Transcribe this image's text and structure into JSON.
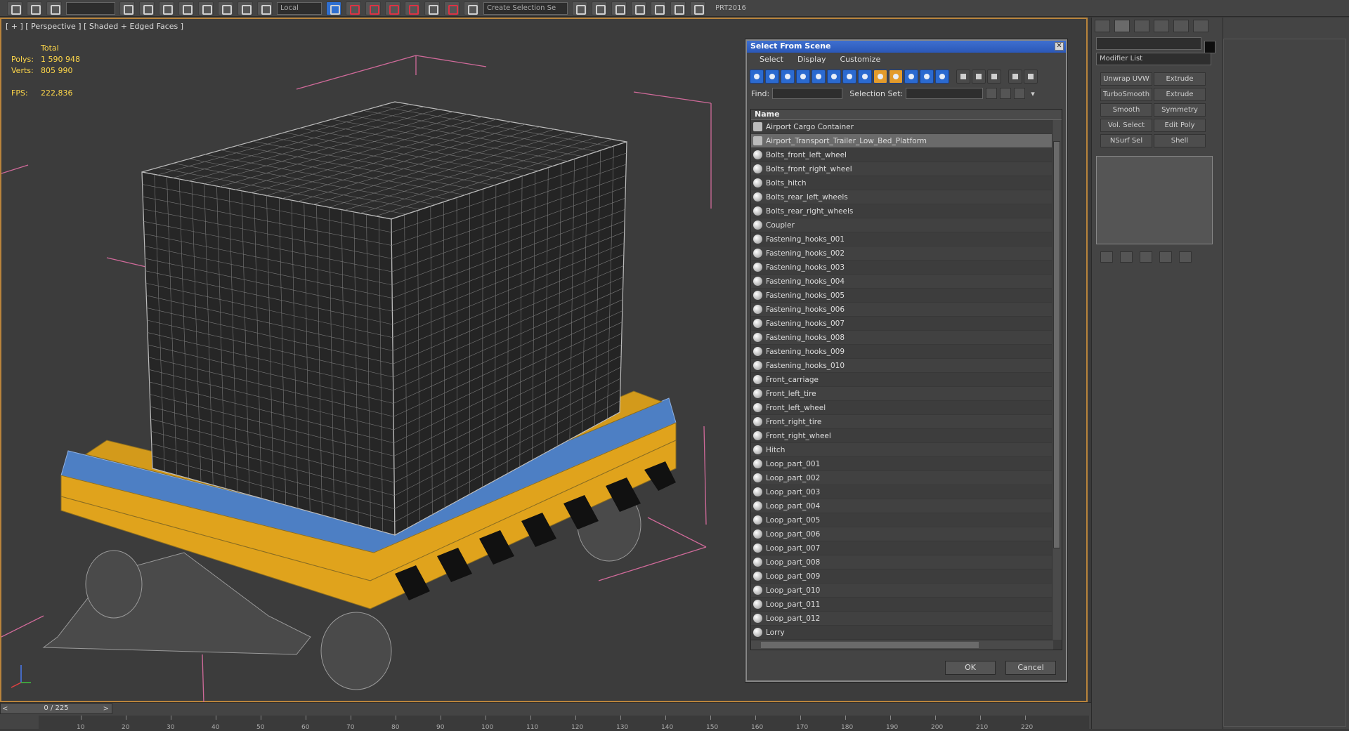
{
  "toolbar": {
    "coord_dropdown": "Local",
    "selection_set": "Create Selection Se",
    "build_label": "PRT2016",
    "icons": [
      "link-icon",
      "unlink-icon",
      "bind-icon",
      "filter-icon",
      "select-icon",
      "select-by-name-icon",
      "region-icon",
      "window-crossing-icon",
      "move-icon",
      "rotate-icon",
      "scale-icon",
      "pivot-icon",
      "snap-icon",
      "angle-snap-icon",
      "percent-snap-icon",
      "spinner-snap-icon",
      "edit-named-sel-icon",
      "mirror-icon",
      "align-icon",
      "layers-icon",
      "curve-editor-icon",
      "schematic-icon",
      "material-editor-icon",
      "render-setup-icon",
      "render-frame-icon",
      "render-icon"
    ]
  },
  "viewport": {
    "label": "[ + ] [ Perspective ] [ Shaded + Edged Faces ]",
    "stats": {
      "total_label": "Total",
      "polys_label": "Polys:",
      "polys_value": "1 590 948",
      "verts_label": "Verts:",
      "verts_value": "805 990",
      "fps_label": "FPS:",
      "fps_value": "222,836"
    }
  },
  "dialog": {
    "title": "Select From Scene",
    "close_glyph": "✕",
    "menu": [
      "Select",
      "Display",
      "Customize"
    ],
    "find_label": "Find:",
    "selection_set_label": "Selection Set:",
    "column_header": "Name",
    "items": [
      {
        "name": "Airport Cargo Container",
        "group": true
      },
      {
        "name": "Airport_Transport_Trailer_Low_Bed_Platform",
        "group": true,
        "highlighted": true
      },
      {
        "name": "Bolts_front_left_wheel"
      },
      {
        "name": "Bolts_front_right_wheel"
      },
      {
        "name": "Bolts_hitch"
      },
      {
        "name": "Bolts_rear_left_wheels"
      },
      {
        "name": "Bolts_rear_right_wheels"
      },
      {
        "name": "Coupler"
      },
      {
        "name": "Fastening_hooks_001"
      },
      {
        "name": "Fastening_hooks_002"
      },
      {
        "name": "Fastening_hooks_003"
      },
      {
        "name": "Fastening_hooks_004"
      },
      {
        "name": "Fastening_hooks_005"
      },
      {
        "name": "Fastening_hooks_006"
      },
      {
        "name": "Fastening_hooks_007"
      },
      {
        "name": "Fastening_hooks_008"
      },
      {
        "name": "Fastening_hooks_009"
      },
      {
        "name": "Fastening_hooks_010"
      },
      {
        "name": "Front_carriage"
      },
      {
        "name": "Front_left_tire"
      },
      {
        "name": "Front_left_wheel"
      },
      {
        "name": "Front_right_tire"
      },
      {
        "name": "Front_right_wheel"
      },
      {
        "name": "Hitch"
      },
      {
        "name": "Loop_part_001"
      },
      {
        "name": "Loop_part_002"
      },
      {
        "name": "Loop_part_003"
      },
      {
        "name": "Loop_part_004"
      },
      {
        "name": "Loop_part_005"
      },
      {
        "name": "Loop_part_006"
      },
      {
        "name": "Loop_part_007"
      },
      {
        "name": "Loop_part_008"
      },
      {
        "name": "Loop_part_009"
      },
      {
        "name": "Loop_part_010"
      },
      {
        "name": "Loop_part_011"
      },
      {
        "name": "Loop_part_012"
      },
      {
        "name": "Lorry"
      }
    ],
    "ok_label": "OK",
    "cancel_label": "Cancel"
  },
  "command_panel": {
    "modifier_list": "Modifier List",
    "modifier_buttons": [
      "Unwrap UVW",
      "Extrude",
      "TurboSmooth",
      "Extrude",
      "Smooth",
      "Symmetry",
      "Vol. Select",
      "Edit Poly",
      "NSurf Sel",
      "Shell"
    ],
    "object_color": "#0e0e0e"
  },
  "timeline": {
    "frame_display": "0 / 225",
    "left_arrow": "<",
    "right_arrow": ">",
    "ticks": [
      "10",
      "20",
      "30",
      "40",
      "50",
      "60",
      "70",
      "80",
      "90",
      "100",
      "110",
      "120",
      "130",
      "140",
      "150",
      "160",
      "170",
      "180",
      "190",
      "200",
      "210",
      "220"
    ]
  },
  "colors": {
    "viewport_border": "#b9843c",
    "stats_text": "#ffd84a",
    "dialog_title": "#2b58b8",
    "trailer_yellow": "#e0a31c",
    "trailer_blue": "#4d7fc4",
    "bbox_pink": "#d06a9a"
  }
}
